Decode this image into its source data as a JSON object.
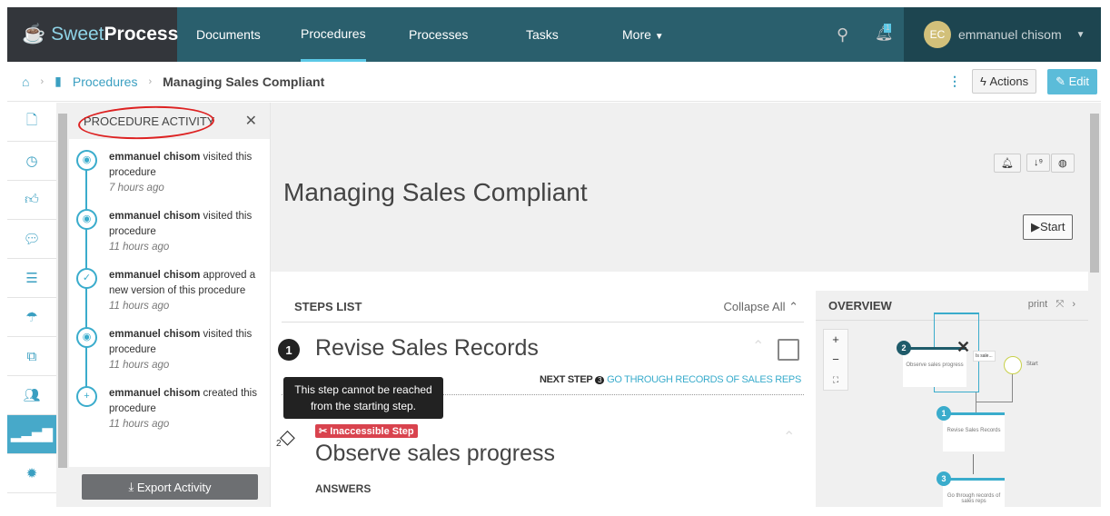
{
  "app": {
    "logo_light": "Sweet",
    "logo_bold": "Process"
  },
  "nav": {
    "items": [
      "Documents",
      "Procedures",
      "Processes",
      "Tasks",
      "More"
    ],
    "active": "Procedures",
    "notification_count": "1",
    "user_initials": "EC",
    "user_name": "emmanuel chisom"
  },
  "breadcrumb": {
    "section": "Procedures",
    "current": "Managing Sales Compliant"
  },
  "toolbar": {
    "actions": "Actions",
    "edit": "Edit"
  },
  "activity": {
    "title": "PROCEDURE ACTIVITY",
    "events": [
      {
        "icon": "eye-icon",
        "user": "emmanuel chisom",
        "action": " visited this procedure",
        "time": "7 hours ago"
      },
      {
        "icon": "eye-icon",
        "user": "emmanuel chisom",
        "action": " visited this procedure",
        "time": "11 hours ago"
      },
      {
        "icon": "check-icon",
        "user": "emmanuel chisom",
        "action": " approved a new version of this procedure",
        "time": "11 hours ago"
      },
      {
        "icon": "eye-icon",
        "user": "emmanuel chisom",
        "action": " visited this procedure",
        "time": "11 hours ago"
      },
      {
        "icon": "plus-icon",
        "user": "emmanuel chisom",
        "action": " created this procedure",
        "time": "11 hours ago"
      }
    ],
    "export": "Export Activity"
  },
  "procedure": {
    "title": "Managing Sales Compliant",
    "start": "Start"
  },
  "steps": {
    "header": "STEPS LIST",
    "collapse": "Collapse All",
    "step1": {
      "num": "1",
      "title": "Revise Sales Records",
      "next_label": "NEXT STEP",
      "next_num": "3",
      "next_title": "GO THROUGH RECORDS OF SALES REPS"
    },
    "tooltip": "This step cannot be reached from the starting step.",
    "badge": "Inaccessible Step",
    "step2": {
      "num": "2",
      "title": "Observe sales progress"
    },
    "answers": "ANSWERS"
  },
  "overview": {
    "title": "OVERVIEW",
    "print": "print",
    "nodes": [
      {
        "num": "2",
        "label": "Observe sales progress"
      },
      {
        "num": "1",
        "label": "Revise Sales Records"
      },
      {
        "num": "3",
        "label": "Go through records of sales reps"
      }
    ],
    "decision_label": "Is sale...",
    "start": "Start"
  },
  "colors": {
    "nav": "#2a5f6d",
    "accent": "#3aaccc",
    "danger": "#d9434e"
  }
}
